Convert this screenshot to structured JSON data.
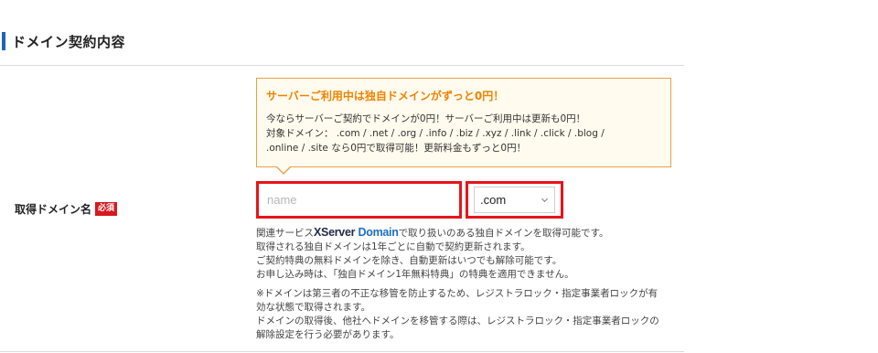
{
  "section": {
    "title": "ドメイン契約内容"
  },
  "field": {
    "label": "取得ドメイン名",
    "required_badge": "必須"
  },
  "promo": {
    "heading": "サーバーご利用中は独自ドメインがずっと0円！",
    "lines": [
      "今ならサーバーご契約でドメインが0円！サーバーご利用中は更新も0円！",
      "対象ドメイン： .com / .net / .org / .info / .biz / .xyz / .link / .click / .blog /",
      ".online / .site なら0円で取得可能！更新料金もずっと0円！"
    ],
    "colors": {
      "heading": "#f08300",
      "border": "#e6a24a",
      "background": "#fffbee"
    }
  },
  "domain_input": {
    "placeholder": "name",
    "value": ""
  },
  "tld_select": {
    "selected": ".com",
    "icon": "chevron-down-icon"
  },
  "notes": {
    "first_prefix": "関連サービス",
    "brand_x": "XServer",
    "brand_domain": "Domain",
    "first_suffix": "で取り扱いのある独自ドメインを取得可能です。",
    "lines": [
      "取得される独自ドメインは1年ごとに自動で契約更新されます。",
      "ご契約特典の無料ドメインを除き、自動更新はいつでも解除可能です。",
      "お申し込み時は、「独自ドメイン1年無料特典」の特典を適用できません。"
    ],
    "caution_lines": [
      "※ドメインは第三者の不正な移管を防止するため、レジストラロック・指定事業者ロックが有",
      "効な状態で取得されます。",
      "ドメインの取得後、他社へドメインを移管する際は、レジストラロック・指定事業者ロックの",
      "解除設定を行う必要があります。"
    ]
  },
  "colors": {
    "accent": "#1d64b8",
    "highlight": "#e8141b",
    "badge": "#d6191e"
  }
}
